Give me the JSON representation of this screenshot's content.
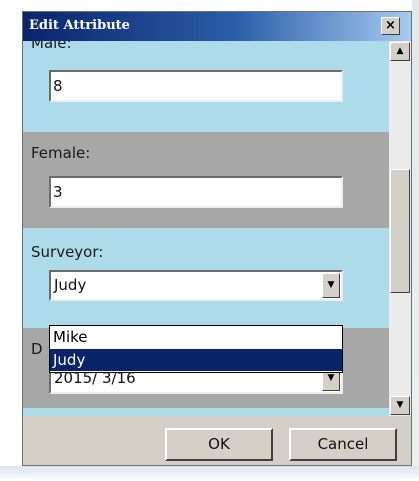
{
  "dialog": {
    "title": "Edit Attribute",
    "close_label": "×"
  },
  "fields": {
    "male": {
      "label": "Male:",
      "value": "8"
    },
    "female": {
      "label": "Female:",
      "value": "3"
    },
    "surveyor": {
      "label": "Surveyor:",
      "value": "Judy",
      "options": [
        "Mike",
        "Judy"
      ],
      "selected_option": "Judy"
    },
    "date": {
      "label_visible": "D",
      "value": "2015/  3/16"
    }
  },
  "scrollbar": {
    "up_arrow": "▲",
    "down_arrow": "▼"
  },
  "buttons": {
    "ok": "OK",
    "cancel": "Cancel"
  },
  "icons": {
    "dropdown_arrow": "▼",
    "close": "close-icon"
  },
  "colors": {
    "title_start": "#0a246a",
    "title_end": "#a6caf0",
    "band_blue": "#aedbea",
    "band_gray": "#a7a7a7",
    "selection": "#0a246a"
  }
}
